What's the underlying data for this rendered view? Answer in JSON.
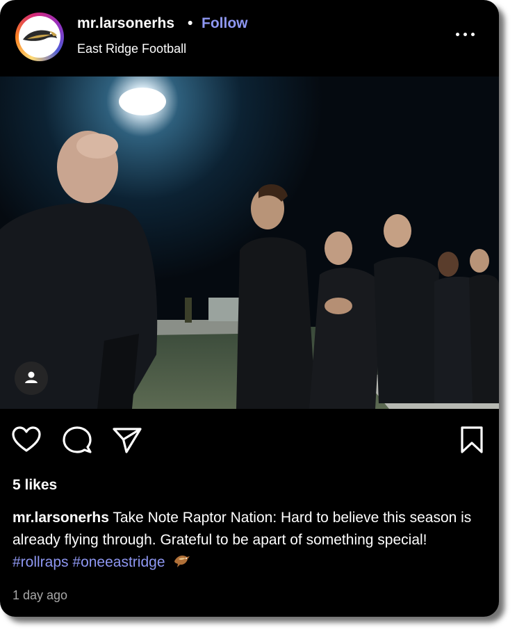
{
  "post": {
    "username": "mr.larsonerhs",
    "separator": "•",
    "follow_label": "Follow",
    "subtitle": "East Ridge Football",
    "more_icon": "more-horizontal-icon",
    "likes": "5 likes",
    "caption": {
      "username": "mr.larsonerhs",
      "text": "Take Note Raptor Nation: Hard to believe this season is already flying through. Grateful to be apart of something special!",
      "hashtags": [
        "#rollraps",
        "#oneeastridge"
      ],
      "emoji_icon": "eagle-emoji-icon"
    },
    "timestamp": "1 day ago"
  },
  "actions": {
    "like_icon": "heart-icon",
    "comment_icon": "comment-icon",
    "share_icon": "send-icon",
    "save_icon": "bookmark-icon",
    "tag_icon": "person-tag-icon"
  },
  "colors": {
    "background": "#000000",
    "link": "#8e97f2",
    "muted": "#a8a8a8",
    "text": "#ffffff"
  }
}
